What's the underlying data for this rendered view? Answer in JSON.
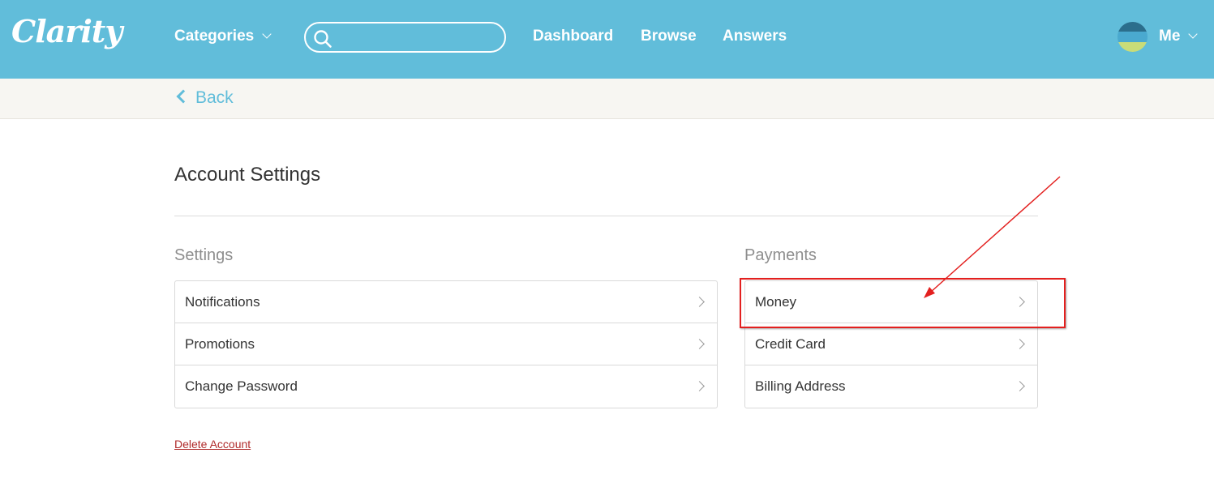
{
  "header": {
    "logo": "Clarity",
    "categories_label": "Categories",
    "search_placeholder": "",
    "nav": [
      "Dashboard",
      "Browse",
      "Answers"
    ],
    "user_label": "Me"
  },
  "subnav": {
    "back_label": "Back"
  },
  "main": {
    "title": "Account Settings",
    "settings": {
      "title": "Settings",
      "items": [
        "Notifications",
        "Promotions",
        "Change Password"
      ]
    },
    "payments": {
      "title": "Payments",
      "items": [
        "Money",
        "Credit Card",
        "Billing Address"
      ]
    },
    "delete_label": "Delete Account"
  },
  "colors": {
    "header": "#61bdda",
    "annotation": "#e3201f",
    "delete_link": "#b02b2b"
  }
}
